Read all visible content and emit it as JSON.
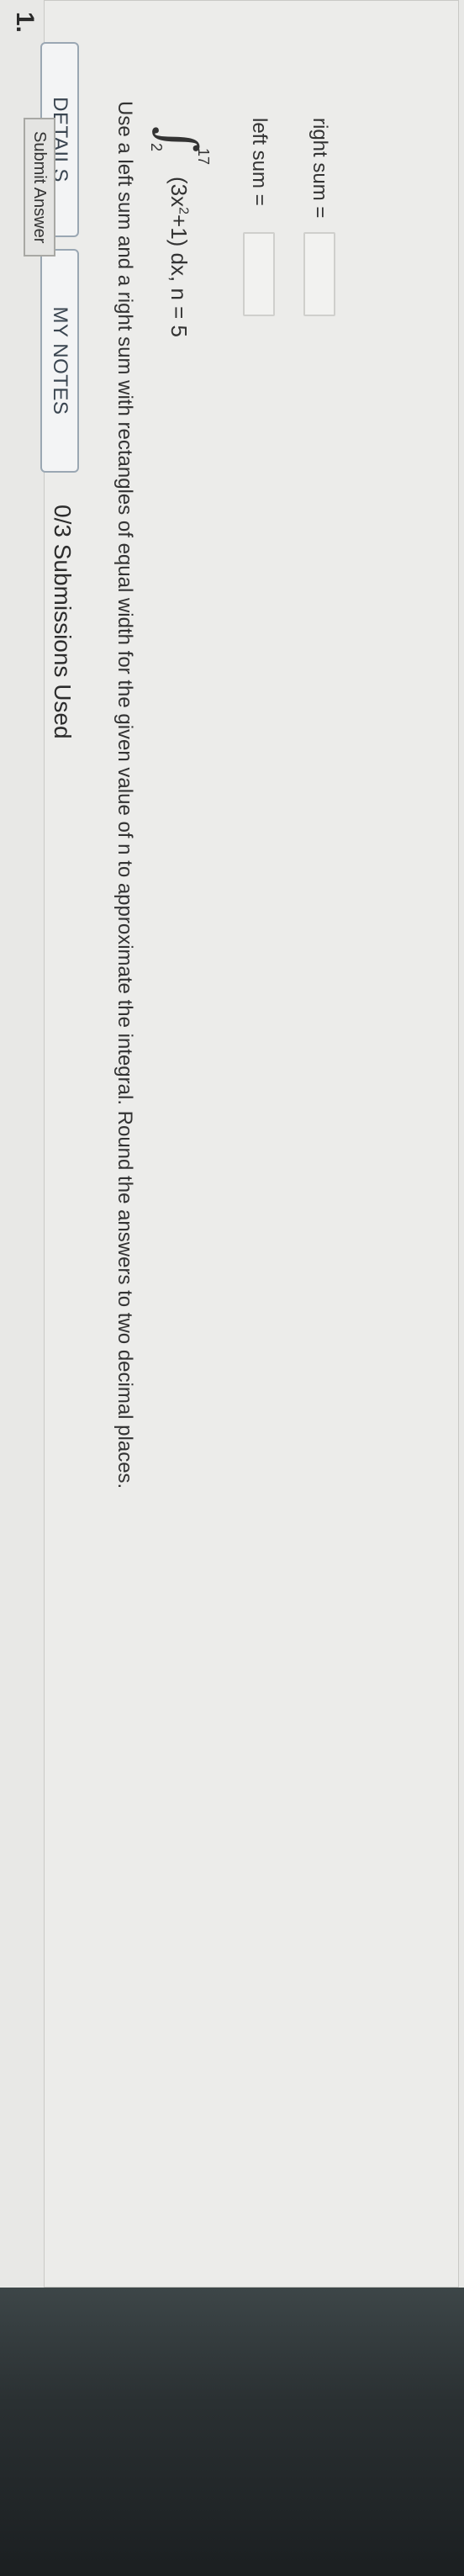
{
  "question": {
    "number": "1.",
    "tabs": {
      "details": "DETAILS",
      "my_notes": "MY NOTES"
    },
    "submissions": "0/3 Submissions Used",
    "instruction": "Use a left sum and a right sum with rectangles of equal width for the given value of n to approximate the integral. Round the answers to two decimal places.",
    "integral": {
      "upper": "17",
      "lower": "2",
      "integrand_prefix": "(3x",
      "exponent": "2",
      "integrand_suffix": "+1) dx, n = 5"
    },
    "answers": {
      "left_label": "left sum =",
      "left_value": "",
      "right_label": "right sum =",
      "right_value": ""
    },
    "submit_label": "Submit Answer"
  }
}
